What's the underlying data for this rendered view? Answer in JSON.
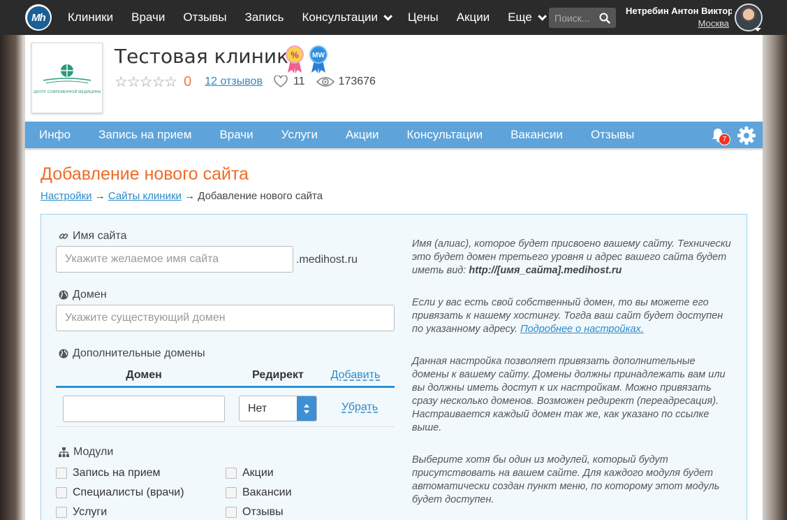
{
  "topbar": {
    "logo_text": "Mh",
    "nav": [
      {
        "label": "Клиники"
      },
      {
        "label": "Врачи"
      },
      {
        "label": "Отзывы"
      },
      {
        "label": "Запись"
      },
      {
        "label": "Консультации",
        "dropdown": true
      },
      {
        "label": "Цены"
      },
      {
        "label": "Акции"
      },
      {
        "label": "Еще",
        "dropdown": true
      }
    ],
    "search_placeholder": "Поиск...",
    "user_name": "Нетребин Антон Викторо",
    "user_city": "Москва"
  },
  "clinic": {
    "title": "Тестовая клиника",
    "rating": "0",
    "reviews_link": "12 отзывов",
    "likes": "11",
    "views": "173676",
    "badge1": "%",
    "badge2": "MW",
    "logo_caption": "ЦЕНТР СОВРЕМЕННОЙ МЕДИЦИНЫ"
  },
  "menu": {
    "items": [
      "Инфо",
      "Запись на прием",
      "Врачи",
      "Услуги",
      "Акции",
      "Консультации",
      "Вакансии",
      "Отзывы"
    ],
    "notifications": "7"
  },
  "section": {
    "title": "Добавление нового сайта",
    "breadcrumb": {
      "b1": "Настройки",
      "sep": "→",
      "b2": "Сайты клиники",
      "b3": "Добавление нового сайта"
    }
  },
  "form": {
    "site_name_label": "Имя сайта",
    "site_name_placeholder": "Укажите желаемое имя сайта",
    "site_name_suffix": ".medihost.ru",
    "domain_label": "Домен",
    "domain_placeholder": "Укажите существующий домен",
    "extra_domains_label": "Дополнительные домены",
    "table": {
      "col_domain": "Домен",
      "col_redirect": "Редирект",
      "add_link": "Добавить",
      "remove_link": "Убрать",
      "redirect_value": "Нет"
    },
    "modules_label": "Модули",
    "modules": [
      "Запись на прием",
      "Акции",
      "Специалисты (врачи)",
      "Вакансии",
      "Услуги",
      "Отзывы"
    ],
    "hint1_pre": "Имя (алиас), которое будет присвоено вашему сайту. Технически это будет домен третьего уровня и адрес вашего сайта будет иметь вид: ",
    "hint1_bold": "http://[имя_сайта].medihost.ru",
    "hint2_pre": "Если у вас есть свой собственный домен, то вы можете его привязать к нашему хостингу. Тогда ваш сайт будет доступен по указанному адресу. ",
    "hint2_link": "Подробнее о настройках.",
    "hint3": "Данная настройка позволяет привязать дополнительные домены к вашему сайту. Домены должны принадлежать вам или вы должны иметь доступ к их настройкам. Можно привязать сразу несколько доменов. Возможен редирект (переадресация). Настраивается каждый домен так же, как указано по ссылке выше.",
    "hint4": "Выберите хотя бы один из модулей, который будут присутствовать на вашем сайте. Для каждого модуля будет автоматически создан пункт меню, по которому этот модуль будет доступен."
  }
}
